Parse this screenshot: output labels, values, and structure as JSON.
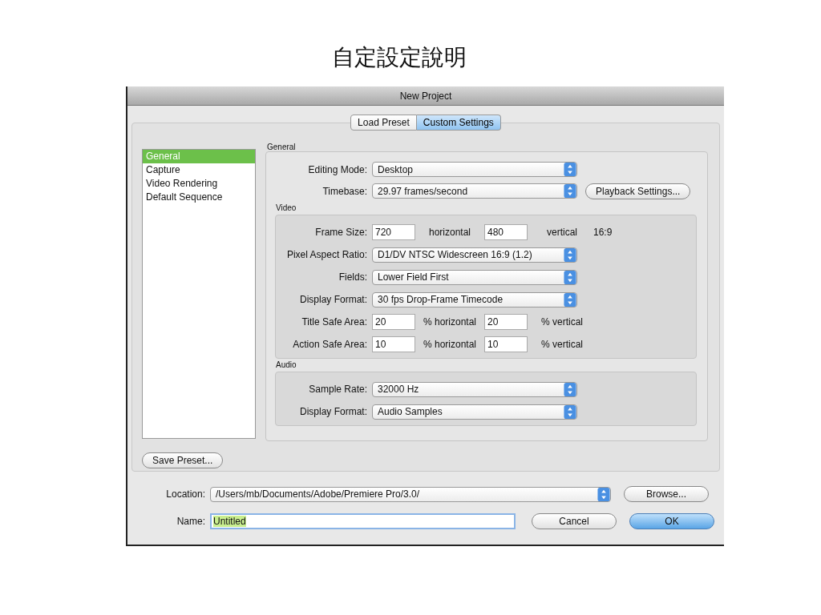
{
  "slide_title": "自定設定說明",
  "window": {
    "title": "New Project"
  },
  "tabs": [
    {
      "label": "Load Preset",
      "selected": false
    },
    {
      "label": "Custom Settings",
      "selected": true
    }
  ],
  "sidebar": {
    "items": [
      {
        "label": "General",
        "selected": true
      },
      {
        "label": "Capture",
        "selected": false
      },
      {
        "label": "Video Rendering",
        "selected": false
      },
      {
        "label": "Default Sequence",
        "selected": false
      }
    ]
  },
  "general": {
    "heading": "General",
    "rows": [
      {
        "kind": "select",
        "label": "Editing Mode:",
        "value": "Desktop"
      },
      {
        "kind": "select",
        "label": "Timebase:",
        "value": "29.97 frames/second",
        "button": "Playback Settings..."
      }
    ]
  },
  "video": {
    "heading": "Video",
    "rows": [
      {
        "kind": "pair",
        "label": "Frame Size:",
        "first": "720",
        "first_unit": "horizontal",
        "second": "480",
        "second_unit": "vertical",
        "note": "16:9"
      },
      {
        "kind": "select",
        "label": "Pixel Aspect Ratio:",
        "value": "D1/DV NTSC Widescreen 16:9 (1.2)"
      },
      {
        "kind": "select",
        "label": "Fields:",
        "value": "Lower Field First"
      },
      {
        "kind": "select",
        "label": "Display Format:",
        "value": "30 fps Drop-Frame Timecode"
      },
      {
        "kind": "pair",
        "label": "Title Safe Area:",
        "first": "20",
        "first_unit": "% horizontal",
        "second": "20",
        "second_unit": "% vertical"
      },
      {
        "kind": "pair",
        "label": "Action Safe Area:",
        "first": "10",
        "first_unit": "% horizontal",
        "second": "10",
        "second_unit": "% vertical"
      }
    ]
  },
  "audio": {
    "heading": "Audio",
    "rows": [
      {
        "kind": "select",
        "label": "Sample Rate:",
        "value": "32000 Hz"
      },
      {
        "kind": "select",
        "label": "Display Format:",
        "value": "Audio Samples"
      }
    ]
  },
  "save_preset": "Save Preset...",
  "location": {
    "label": "Location:",
    "value": "/Users/mb/Documents/Adobe/Premiere Pro/3.0/",
    "button": "Browse..."
  },
  "name": {
    "label": "Name:",
    "value": "Untitled",
    "text_selected": true
  },
  "buttons": [
    {
      "label": "Cancel",
      "default": false
    },
    {
      "label": "OK",
      "default": true
    }
  ]
}
